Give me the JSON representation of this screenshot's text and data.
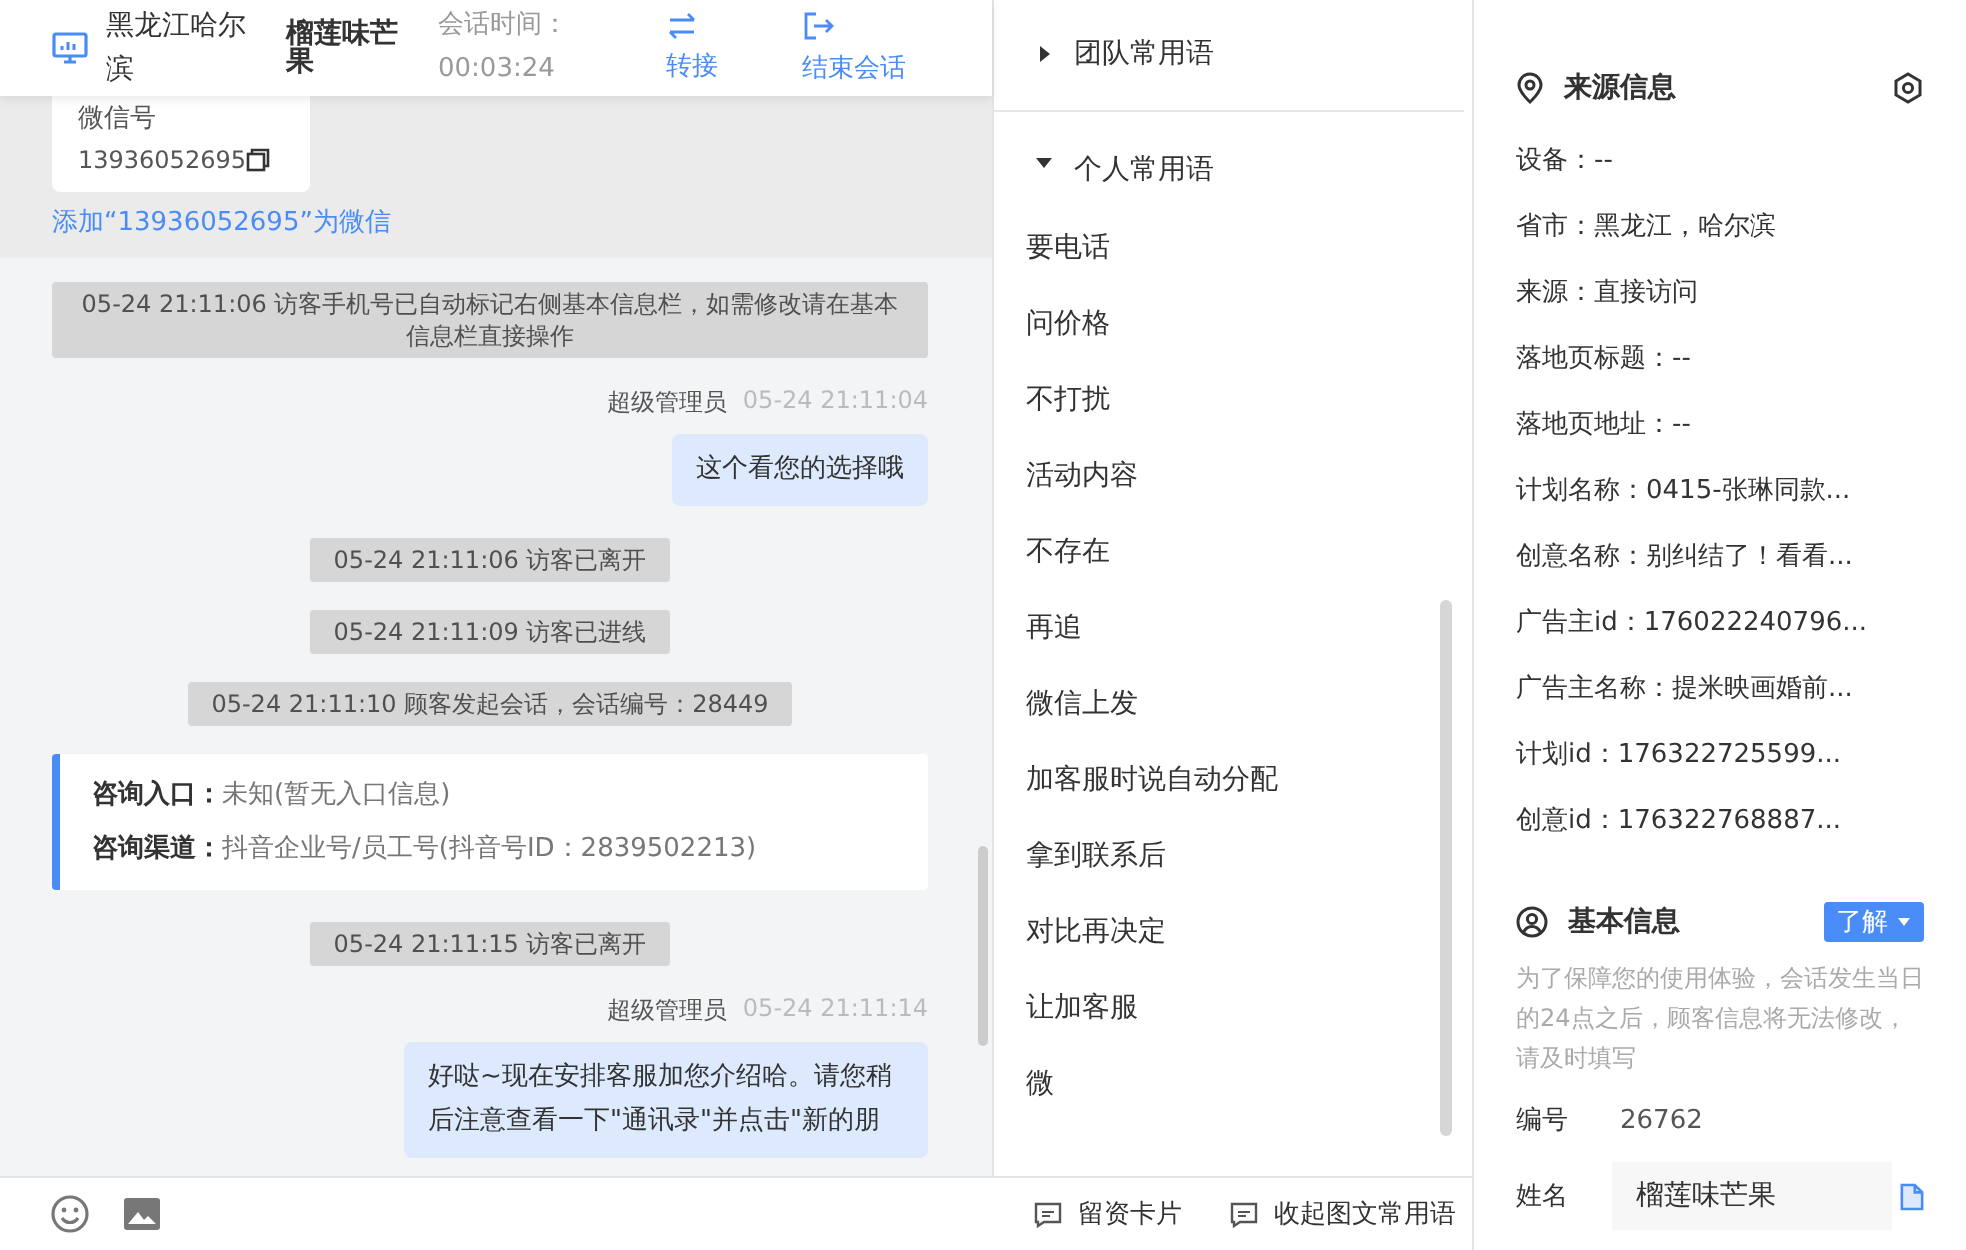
{
  "header": {
    "location": "黑龙江哈尔滨",
    "visitor": "榴莲味芒果",
    "duration_label": "会话时间：",
    "duration": "00:03:24",
    "actions": [
      {
        "label": "转接",
        "kind": "transfer"
      },
      {
        "label": "结束会话",
        "kind": "end"
      }
    ]
  },
  "wechat_card": {
    "label": "微信号",
    "number": "13936052695",
    "add_link": "添加“13936052695”为微信"
  },
  "messages": [
    {
      "kind": "system",
      "text": "05-24 21:11:06 访客手机号已自动标记右侧基本信息栏，如需修改请在基本信息栏直接操作"
    },
    {
      "kind": "agent",
      "sender": "超级管理员",
      "time": "05-24 21:11:04",
      "text": "这个看您的选择哦"
    },
    {
      "kind": "system",
      "text": "05-24 21:11:06 访客已离开"
    },
    {
      "kind": "system",
      "text": "05-24 21:11:09 访客已进线"
    },
    {
      "kind": "system",
      "text": "05-24 21:11:10 顾客发起会话，会话编号：28449"
    },
    {
      "kind": "info",
      "rows": [
        {
          "label": "咨询入口：",
          "value": "未知(暂无入口信息)"
        },
        {
          "label": "咨询渠道：",
          "value": "抖音企业号/员工号(抖音号ID：2839502213)"
        }
      ]
    },
    {
      "kind": "system",
      "text": "05-24 21:11:15 访客已离开"
    },
    {
      "kind": "agent",
      "sender": "超级管理员",
      "time": "05-24 21:11:14",
      "text": "好哒~现在安排客服加您介绍哈。请您稍后注意查看一下\"通讯录\"并点击\"新的朋"
    }
  ],
  "phrases": {
    "groups": [
      {
        "label": "团队常用语",
        "expanded": false
      },
      {
        "label": "个人常用语",
        "expanded": true,
        "items": [
          "要电话",
          "问价格",
          "不打扰",
          "活动内容",
          "不存在",
          "再追",
          "微信上发",
          "加客服时说自动分配",
          "拿到联系后",
          "对比再决定",
          "让加客服",
          "微"
        ]
      }
    ],
    "footer_buttons": [
      "留资卡片",
      "收起图文常用语"
    ]
  },
  "source_info": {
    "title": "来源信息",
    "rows": [
      "设备：--",
      "省市：黑龙江，哈尔滨",
      "来源：直接访问",
      "落地页标题：--",
      "落地页地址：--",
      "计划名称：0415-张琳同款...",
      "创意名称：别纠结了！看看...",
      "广告主id：176022240796...",
      "广告主名称：提米映画婚前...",
      "计划id：176322725599...",
      "创意id：176322768887..."
    ]
  },
  "basic_info": {
    "title": "基本信息",
    "dropdown": "了解",
    "notice": "为了保障您的使用体验，会话发生当日的24点之后，顾客信息将无法修改，请及时填写",
    "fields": [
      {
        "label": "编号",
        "value": "26762",
        "kind": "text"
      },
      {
        "label": "姓名",
        "value": "榴莲味芒果",
        "kind": "input"
      }
    ]
  }
}
